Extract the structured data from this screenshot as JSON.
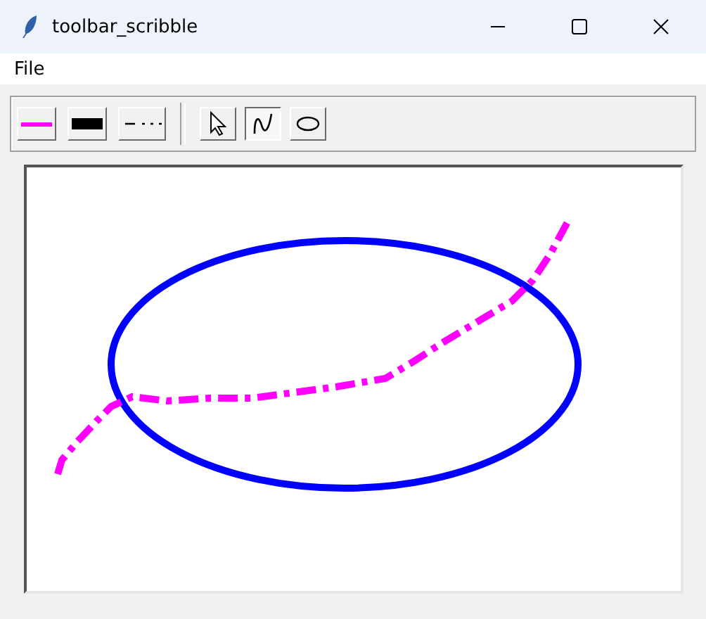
{
  "window": {
    "title": "toolbar_scribble"
  },
  "menu": [
    "File"
  ],
  "style_buttons": [
    {
      "kind": "color",
      "color": "#ff00ff"
    },
    {
      "kind": "width"
    },
    {
      "kind": "dash"
    }
  ],
  "tool_buttons": [
    {
      "kind": "select",
      "selected": false
    },
    {
      "kind": "freehand",
      "selected": true
    },
    {
      "kind": "ellipse",
      "selected": false
    }
  ]
}
